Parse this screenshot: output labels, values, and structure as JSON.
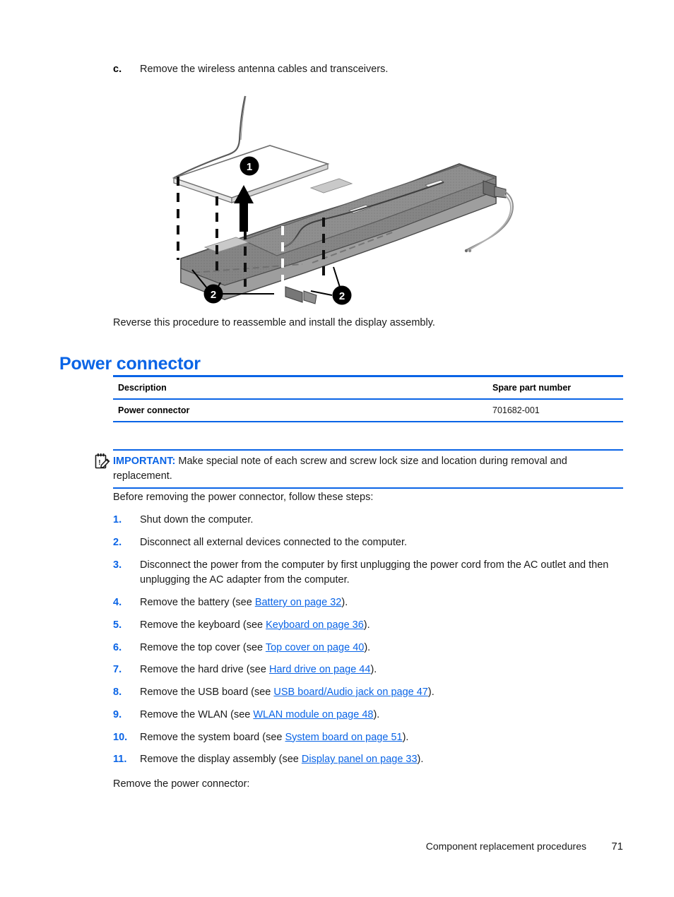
{
  "sub_step": {
    "marker": "c.",
    "text": "Remove the wireless antenna cables and transceivers."
  },
  "figure": {
    "caption_callouts": [
      "1",
      "2",
      "2"
    ],
    "alt": "Exploded view illustration of a notebook display back cover with wireless antenna cables and transceivers being removed"
  },
  "paragraphs": {
    "reverse": "Reverse this procedure to reassemble and install the display assembly.",
    "before_steps": "Before removing the power connector, follow these steps:",
    "final": "Remove the power connector:"
  },
  "heading": "Power connector",
  "parts_table": {
    "headers": {
      "description": "Description",
      "spare_part_number": "Spare part number"
    },
    "rows": [
      {
        "description": "Power connector",
        "spare_part_number": "701682-001"
      }
    ]
  },
  "note": {
    "icon": "important-note-icon",
    "label": "IMPORTANT:",
    "text": "Make special note of each screw and screw lock size and location during removal and replacement."
  },
  "steps": [
    {
      "num": "1.",
      "pre": "Shut down the computer.",
      "link": "",
      "post": ""
    },
    {
      "num": "2.",
      "pre": "Disconnect all external devices connected to the computer.",
      "link": "",
      "post": ""
    },
    {
      "num": "3.",
      "pre": "Disconnect the power from the computer by first unplugging the power cord from the AC outlet and then unplugging the AC adapter from the computer.",
      "link": "",
      "post": ""
    },
    {
      "num": "4.",
      "pre": "Remove the battery (see ",
      "link": "Battery on page 32",
      "post": ")."
    },
    {
      "num": "5.",
      "pre": "Remove the keyboard (see ",
      "link": "Keyboard on page 36",
      "post": ")."
    },
    {
      "num": "6.",
      "pre": "Remove the top cover (see ",
      "link": "Top cover on page 40",
      "post": ")."
    },
    {
      "num": "7.",
      "pre": "Remove the hard drive (see ",
      "link": "Hard drive on page 44",
      "post": ")."
    },
    {
      "num": "8.",
      "pre": "Remove the USB board (see ",
      "link": "USB board/Audio jack on page 47",
      "post": ")."
    },
    {
      "num": "9.",
      "pre": "Remove the WLAN (see ",
      "link": "WLAN module on page 48",
      "post": ")."
    },
    {
      "num": "10.",
      "pre": "Remove the system board (see ",
      "link": "System board on page 51",
      "post": ")."
    },
    {
      "num": "11.",
      "pre": "Remove the display assembly (see ",
      "link": "Display panel on page 33",
      "post": ")."
    }
  ],
  "footer": {
    "title": "Component replacement procedures",
    "page": "71"
  },
  "colors": {
    "accent_blue": "#0a64e6",
    "text": "#1a1a1a",
    "cover_gray": "#818181",
    "cover_gray_dark": "#6e6e6e",
    "cover_gray_light": "#a8a8a8"
  }
}
